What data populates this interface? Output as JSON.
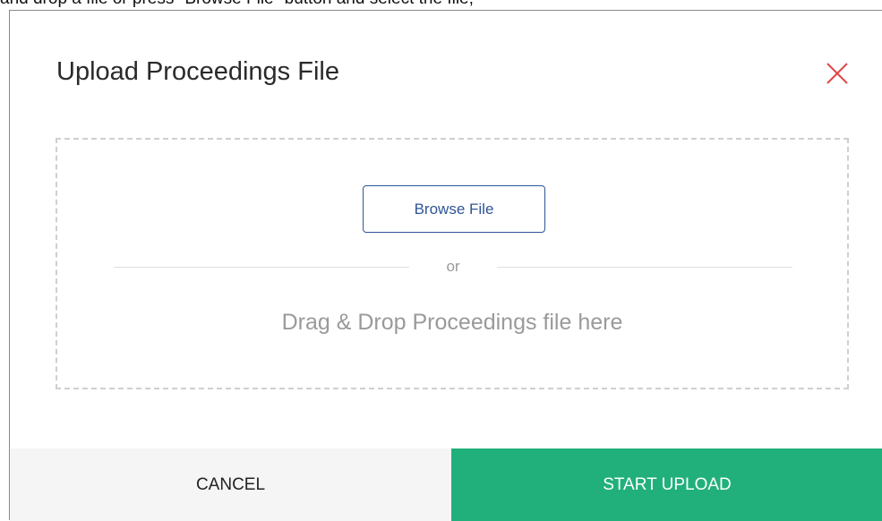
{
  "background": {
    "instruction_text": "and drop a file or press \"Browse File\" button and select the file;"
  },
  "modal": {
    "title": "Upload Proceedings File",
    "close_icon": "close-icon",
    "drop_zone": {
      "browse_label": "Browse File",
      "or_label": "or",
      "drag_text": "Drag & Drop Proceedings file here"
    },
    "footer": {
      "cancel_label": "CANCEL",
      "start_label": "START UPLOAD"
    }
  },
  "colors": {
    "close": "#e0464a",
    "browse_accent": "#2f5597",
    "start_button": "#21b07b",
    "cancel_button": "#f5f5f5"
  }
}
